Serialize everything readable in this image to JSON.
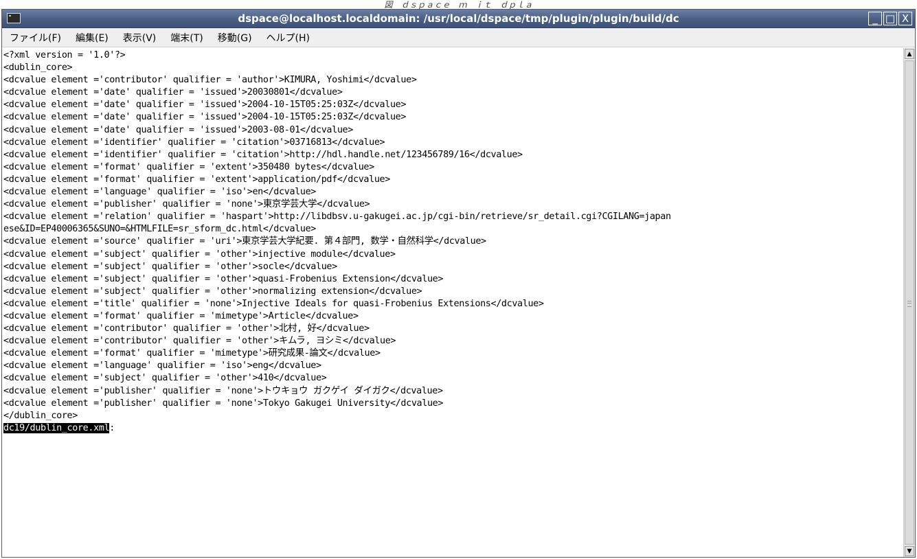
{
  "caption": "図　ｄｓｐａｃｅ　ｍ　ｉｔ　ｄｐｌａ",
  "window": {
    "title": "dspace@localhost.localdomain: /usr/local/dspace/tmp/plugin/plugin/build/dc",
    "icon": "terminal-icon",
    "buttons": {
      "minimize": "_",
      "maximize": "□",
      "close": "X"
    }
  },
  "menubar": {
    "items": [
      {
        "label": "ファイル(F)"
      },
      {
        "label": "編集(E)"
      },
      {
        "label": "表示(V)"
      },
      {
        "label": "端末(T)"
      },
      {
        "label": "移動(G)"
      },
      {
        "label": "ヘルプ(H)"
      }
    ]
  },
  "terminal": {
    "lines": [
      "<?xml version = '1.0'?>",
      "<dublin_core>",
      "<dcvalue element ='contributor' qualifier = 'author'>KIMURA, Yoshimi</dcvalue>",
      "<dcvalue element ='date' qualifier = 'issued'>20030801</dcvalue>",
      "<dcvalue element ='date' qualifier = 'issued'>2004-10-15T05:25:03Z</dcvalue>",
      "<dcvalue element ='date' qualifier = 'issued'>2004-10-15T05:25:03Z</dcvalue>",
      "<dcvalue element ='date' qualifier = 'issued'>2003-08-01</dcvalue>",
      "<dcvalue element ='identifier' qualifier = 'citation'>03716813</dcvalue>",
      "<dcvalue element ='identifier' qualifier = 'citation'>http://hdl.handle.net/123456789/16</dcvalue>",
      "<dcvalue element ='format' qualifier = 'extent'>350480 bytes</dcvalue>",
      "<dcvalue element ='format' qualifier = 'extent'>application/pdf</dcvalue>",
      "<dcvalue element ='language' qualifier = 'iso'>en</dcvalue>",
      "<dcvalue element ='publisher' qualifier = 'none'>東京学芸大学</dcvalue>",
      "<dcvalue element ='relation' qualifier = 'haspart'>http://libdbsv.u-gakugei.ac.jp/cgi-bin/retrieve/sr_detail.cgi?CGILANG=japan",
      "ese&ID=EP40006365&SUNO=&HTMLFILE=sr_sform_dc.html</dcvalue>",
      "<dcvalue element ='source' qualifier = 'uri'>東京学芸大学紀要. 第４部門, 数学・自然科学</dcvalue>",
      "<dcvalue element ='subject' qualifier = 'other'>injective module</dcvalue>",
      "<dcvalue element ='subject' qualifier = 'other'>socle</dcvalue>",
      "<dcvalue element ='subject' qualifier = 'other'>quasi-Frobenius Extension</dcvalue>",
      "<dcvalue element ='subject' qualifier = 'other'>normalizing extension</dcvalue>",
      "<dcvalue element ='title' qualifier = 'none'>Injective Ideals for quasi-Frobenius Extensions</dcvalue>",
      "<dcvalue element ='format' qualifier = 'mimetype'>Article</dcvalue>",
      "<dcvalue element ='contributor' qualifier = 'other'>北村, 好</dcvalue>",
      "<dcvalue element ='contributor' qualifier = 'other'>キムラ, ヨシミ</dcvalue>",
      "<dcvalue element ='format' qualifier = 'mimetype'>研究成果-論文</dcvalue>",
      "<dcvalue element ='language' qualifier = 'iso'>eng</dcvalue>",
      "<dcvalue element ='subject' qualifier = 'other'>410</dcvalue>",
      "<dcvalue element ='publisher' qualifier = 'none'>トウキョウ ガクゲイ ダイガク</dcvalue>",
      "<dcvalue element ='publisher' qualifier = 'none'>Tokyo Gakugei University</dcvalue>",
      "</dublin_core>"
    ],
    "prompt_file": "dc19/dublin_core.xml",
    "prompt_suffix": ":"
  },
  "scrollbar": {
    "up_arrow": "▲",
    "down_arrow": "▼"
  }
}
